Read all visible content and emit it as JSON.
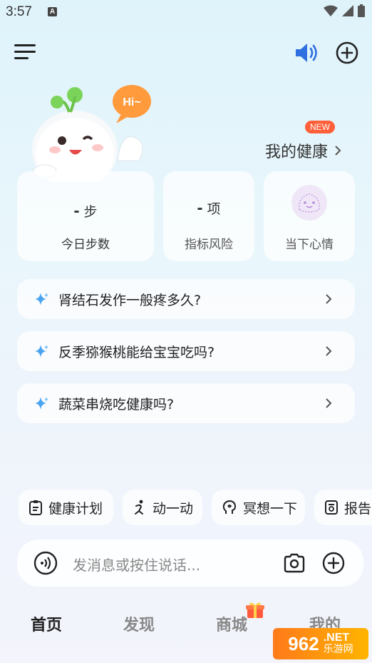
{
  "status_bar": {
    "time": "3:57",
    "notification_letter": "A"
  },
  "header": {
    "menu_icon": "hamburger-menu-icon",
    "speaker_icon": "speaker-icon",
    "add_icon": "plus-circle-icon"
  },
  "mascot": {
    "speech_bubble": "Hi~"
  },
  "my_health": {
    "label": "我的健康",
    "badge": "NEW"
  },
  "cards": [
    {
      "value": "-",
      "unit": "步",
      "label": "今日步数"
    },
    {
      "value": "-",
      "unit": "项",
      "label": "指标风险"
    },
    {
      "label": "当下心情",
      "icon": "mood-face-icon"
    }
  ],
  "questions": [
    "肾结石发作一般疼多久?",
    "反季猕猴桃能给宝宝吃吗?",
    "蔬菜串烧吃健康吗?"
  ],
  "chips": [
    {
      "label": "健康计划",
      "icon": "clipboard-icon"
    },
    {
      "label": "动一动",
      "icon": "exercise-icon"
    },
    {
      "label": "冥想一下",
      "icon": "meditation-icon"
    },
    {
      "label": "报告",
      "icon": "report-icon"
    }
  ],
  "input": {
    "placeholder": "发消息或按住说话..."
  },
  "bottom_nav": [
    {
      "label": "首页",
      "active": true
    },
    {
      "label": "发现",
      "active": false
    },
    {
      "label": "商城",
      "active": false
    },
    {
      "label": "我的",
      "active": false
    }
  ],
  "watermark": {
    "number": "962",
    "suffix": ".NET",
    "sub": "乐游网"
  },
  "colors": {
    "accent_blue": "#2f6fe0",
    "new_badge": "#ff5f39",
    "spark_blue": "#4aa3f0"
  }
}
